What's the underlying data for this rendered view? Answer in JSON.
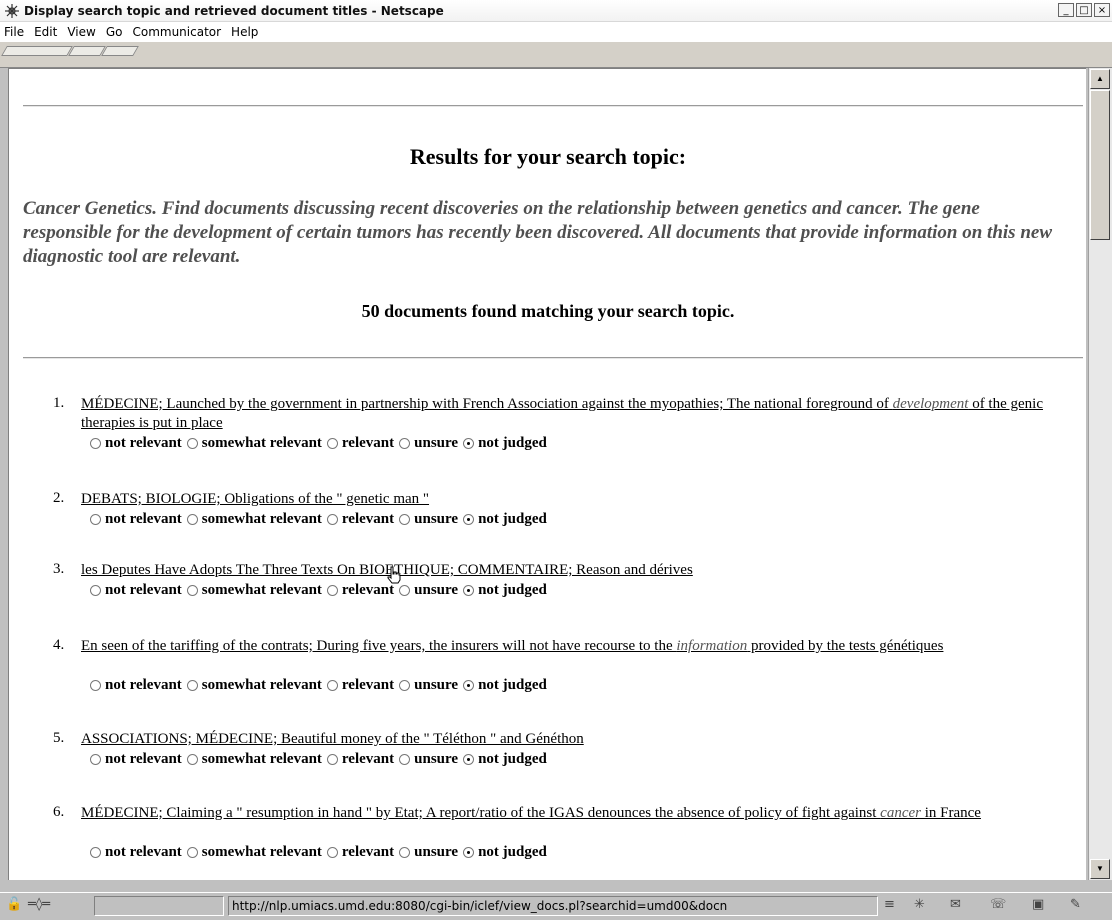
{
  "window": {
    "title": "Display search topic and retrieved document titles - Netscape",
    "controls": [
      "_",
      "□",
      "×"
    ]
  },
  "menu": [
    "File",
    "Edit",
    "View",
    "Go",
    "Communicator",
    "Help"
  ],
  "page": {
    "heading": "Results for your search topic:",
    "topic": "Cancer Genetics. Find documents discussing recent discoveries on the relationship between genetics and cancer. The gene responsible for the development of certain tumors has recently been discovered. All documents that provide information on this new diagnostic tool are relevant.",
    "count_text": "50 documents found matching your search topic.",
    "judgment_options": [
      "not relevant",
      "somewhat relevant",
      "relevant",
      "unsure",
      "not judged"
    ],
    "results": [
      {
        "num": "1.",
        "title_parts": [
          "MÉDECINE; Launched by the government in partnership with French Association against the myopathies; The national foreground of ",
          "development",
          " of the genic therapies is put in place"
        ],
        "selected": "not judged"
      },
      {
        "num": "2.",
        "title_parts": [
          "DEBATS; BIOLOGIE; Obligations of the \" genetic man \"",
          "",
          ""
        ],
        "selected": "not judged"
      },
      {
        "num": "3.",
        "title_parts": [
          "les Deputes Have Adopts The Three Texts On BIOETHIQUE; COMMENTAIRE; Reason and dérives",
          "",
          ""
        ],
        "selected": "not judged"
      },
      {
        "num": "4.",
        "title_parts": [
          "En seen of the tariffing of the contrats; During five years, the insurers will not have recourse to the ",
          "information",
          " provided by the tests génétiques"
        ],
        "selected": "not judged"
      },
      {
        "num": "5.",
        "title_parts": [
          "ASSOCIATIONS; MÉDECINE; Beautiful money of the \" Téléthon \" and Généthon",
          "",
          ""
        ],
        "selected": "not judged"
      },
      {
        "num": "6.",
        "title_parts": [
          "MÉDECINE; Claiming a \" resumption in hand \" by Etat; A report/ratio of the IGAS denounces the absence of policy of fight against ",
          "cancer",
          " in France"
        ],
        "selected": "not judged"
      }
    ]
  },
  "status": {
    "url": "http://nlp.umiacs.umd.edu:8080/cgi-bin/iclef/view_docs.pl?searchid=umd00&docn"
  }
}
